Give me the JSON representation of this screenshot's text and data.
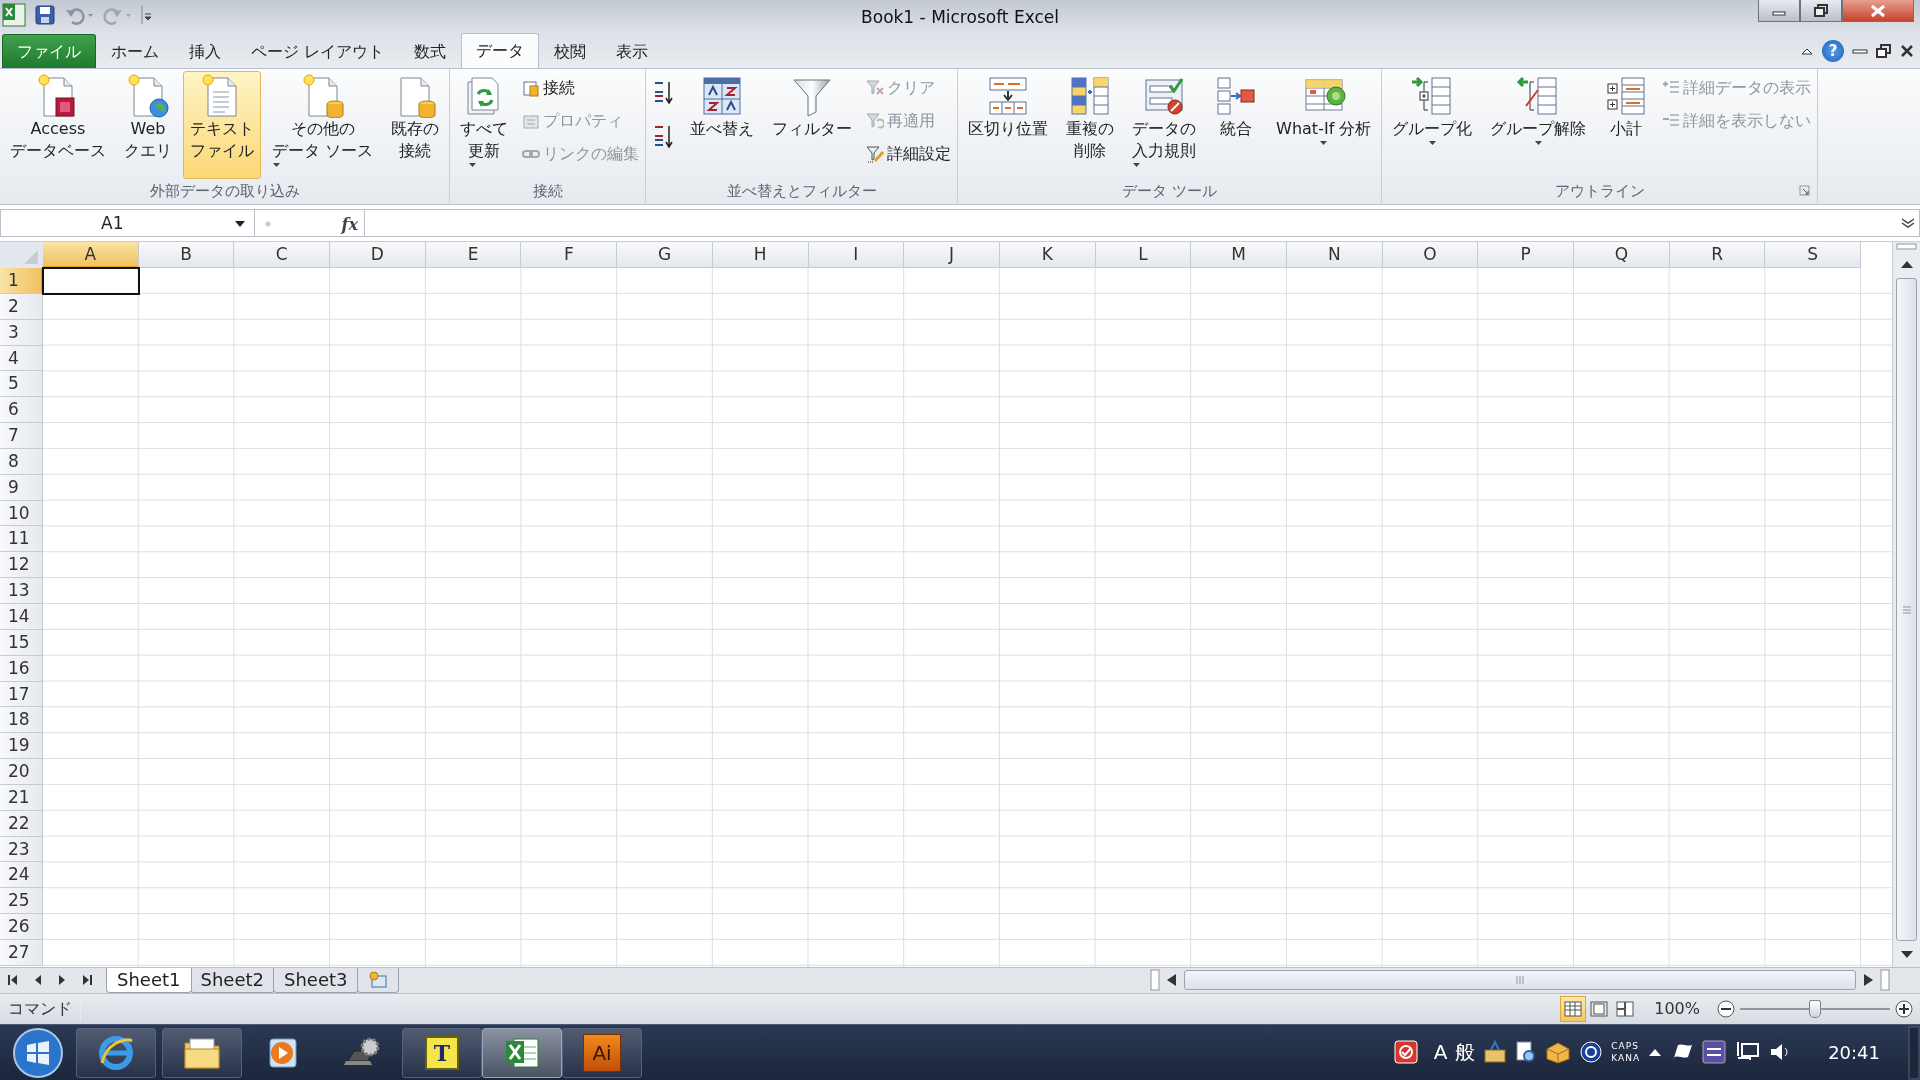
{
  "window": {
    "title": "Book1 - Microsoft Excel"
  },
  "ribbon_tabs": [
    {
      "label": "ファイル",
      "kind": "file",
      "selected": false
    },
    {
      "label": "ホーム",
      "kind": "tab",
      "selected": false
    },
    {
      "label": "挿入",
      "kind": "tab",
      "selected": false
    },
    {
      "label": "ページ レイアウト",
      "kind": "tab",
      "selected": false
    },
    {
      "label": "数式",
      "kind": "tab",
      "selected": false
    },
    {
      "label": "データ",
      "kind": "tab",
      "selected": true
    },
    {
      "label": "校閲",
      "kind": "tab",
      "selected": false
    },
    {
      "label": "表示",
      "kind": "tab",
      "selected": false
    }
  ],
  "help": "?",
  "ribbon_groups": [
    {
      "label": "外部データの取り込み",
      "launcher": false,
      "columns": [
        {
          "kind": "large",
          "lines": [
            "Access",
            "データベース"
          ],
          "dropdown": false,
          "hovered": false
        },
        {
          "kind": "large",
          "lines": [
            "Web",
            "クエリ"
          ],
          "dropdown": false,
          "hovered": false
        },
        {
          "kind": "large",
          "lines": [
            "テキスト",
            "ファイル"
          ],
          "dropdown": false,
          "hovered": true
        },
        {
          "kind": "large",
          "lines": [
            "その他の",
            "データ ソース"
          ],
          "dropdown": true,
          "hovered": false
        },
        {
          "kind": "large",
          "lines": [
            "既存の",
            "接続"
          ],
          "dropdown": false,
          "hovered": false
        }
      ]
    },
    {
      "label": "接続",
      "launcher": false,
      "columns": [
        {
          "kind": "large",
          "lines": [
            "すべて",
            "更新"
          ],
          "dropdown": true,
          "hovered": false
        },
        {
          "kind": "stack",
          "items": [
            {
              "label": "接続",
              "disabled": false
            },
            {
              "label": "プロパティ",
              "disabled": true
            },
            {
              "label": "リンクの編集",
              "disabled": true
            }
          ]
        }
      ]
    },
    {
      "label": "並べ替えとフィルター",
      "launcher": false,
      "columns": [
        {
          "kind": "sort-icons"
        },
        {
          "kind": "large",
          "lines": [
            "並べ替え"
          ],
          "dropdown": false,
          "hovered": false
        },
        {
          "kind": "large",
          "lines": [
            "フィルター"
          ],
          "dropdown": false,
          "hovered": false
        },
        {
          "kind": "stack",
          "items": [
            {
              "label": "クリア",
              "disabled": true
            },
            {
              "label": "再適用",
              "disabled": true
            },
            {
              "label": "詳細設定",
              "disabled": false
            }
          ]
        }
      ]
    },
    {
      "label": "データ ツール",
      "launcher": false,
      "columns": [
        {
          "kind": "large",
          "lines": [
            "区切り位置"
          ],
          "dropdown": false,
          "hovered": false
        },
        {
          "kind": "large",
          "lines": [
            "重複の",
            "削除"
          ],
          "dropdown": false,
          "hovered": false
        },
        {
          "kind": "large",
          "lines": [
            "データの",
            "入力規則"
          ],
          "dropdown": true,
          "hovered": false
        },
        {
          "kind": "large",
          "lines": [
            "統合"
          ],
          "dropdown": false,
          "hovered": false
        },
        {
          "kind": "large",
          "lines": [
            "What-If 分析"
          ],
          "dropdown": true,
          "hovered": false
        }
      ]
    },
    {
      "label": "アウトライン",
      "launcher": true,
      "columns": [
        {
          "kind": "large",
          "lines": [
            "グループ化"
          ],
          "dropdown": true,
          "hovered": false
        },
        {
          "kind": "large",
          "lines": [
            "グループ解除"
          ],
          "dropdown": true,
          "hovered": false
        },
        {
          "kind": "large",
          "lines": [
            "小計"
          ],
          "dropdown": false,
          "hovered": false
        },
        {
          "kind": "stack",
          "items": [
            {
              "label": "詳細データの表示",
              "disabled": true
            },
            {
              "label": "詳細を表示しない",
              "disabled": true
            }
          ]
        }
      ]
    }
  ],
  "formula_bar": {
    "name_box": "A1",
    "fx": "fx"
  },
  "sheet": {
    "columns": [
      {
        "label": "A",
        "selected": true
      },
      {
        "label": "B",
        "selected": false
      },
      {
        "label": "C",
        "selected": false
      },
      {
        "label": "D",
        "selected": false
      },
      {
        "label": "E",
        "selected": false
      },
      {
        "label": "F",
        "selected": false
      },
      {
        "label": "G",
        "selected": false
      },
      {
        "label": "H",
        "selected": false
      },
      {
        "label": "I",
        "selected": false
      },
      {
        "label": "J",
        "selected": false
      },
      {
        "label": "K",
        "selected": false
      },
      {
        "label": "L",
        "selected": false
      },
      {
        "label": "M",
        "selected": false
      },
      {
        "label": "N",
        "selected": false
      },
      {
        "label": "O",
        "selected": false
      },
      {
        "label": "P",
        "selected": false
      },
      {
        "label": "Q",
        "selected": false
      },
      {
        "label": "R",
        "selected": false
      },
      {
        "label": "S",
        "selected": false
      }
    ],
    "rows": [
      {
        "label": "1",
        "selected": true
      },
      {
        "label": "2",
        "selected": false
      },
      {
        "label": "3",
        "selected": false
      },
      {
        "label": "4",
        "selected": false
      },
      {
        "label": "5",
        "selected": false
      },
      {
        "label": "6",
        "selected": false
      },
      {
        "label": "7",
        "selected": false
      },
      {
        "label": "8",
        "selected": false
      },
      {
        "label": "9",
        "selected": false
      },
      {
        "label": "10",
        "selected": false
      },
      {
        "label": "11",
        "selected": false
      },
      {
        "label": "12",
        "selected": false
      },
      {
        "label": "13",
        "selected": false
      },
      {
        "label": "14",
        "selected": false
      },
      {
        "label": "15",
        "selected": false
      },
      {
        "label": "16",
        "selected": false
      },
      {
        "label": "17",
        "selected": false
      },
      {
        "label": "18",
        "selected": false
      },
      {
        "label": "19",
        "selected": false
      },
      {
        "label": "20",
        "selected": false
      },
      {
        "label": "21",
        "selected": false
      },
      {
        "label": "22",
        "selected": false
      },
      {
        "label": "23",
        "selected": false
      },
      {
        "label": "24",
        "selected": false
      },
      {
        "label": "25",
        "selected": false
      },
      {
        "label": "26",
        "selected": false
      },
      {
        "label": "27",
        "selected": false
      }
    ]
  },
  "sheet_tabs": [
    {
      "label": "Sheet1",
      "selected": true
    },
    {
      "label": "Sheet2",
      "selected": false
    },
    {
      "label": "Sheet3",
      "selected": false
    }
  ],
  "status_bar": {
    "mode": "コマンド",
    "views": [
      {
        "selected": true
      },
      {
        "selected": false
      },
      {
        "selected": false
      }
    ],
    "zoom": "100%",
    "zoom_slider": {
      "level": 0.5
    }
  },
  "taskbar": {
    "apps": [
      {
        "kind": "browser",
        "running": true,
        "active": false
      },
      {
        "kind": "folder",
        "running": true,
        "active": false
      },
      {
        "kind": "media",
        "running": false,
        "active": false
      },
      {
        "kind": "laptop",
        "running": false,
        "active": false
      },
      {
        "kind": "typing",
        "label": "T",
        "running": true,
        "active": false
      },
      {
        "kind": "spreadsheet",
        "running": true,
        "active": true
      },
      {
        "kind": "illustrator",
        "label": "Ai",
        "running": true,
        "active": false
      }
    ],
    "ime_mode": "A",
    "ime_input": "般",
    "caps": "CAPS",
    "kana": "KANA",
    "clock": "20:41"
  }
}
